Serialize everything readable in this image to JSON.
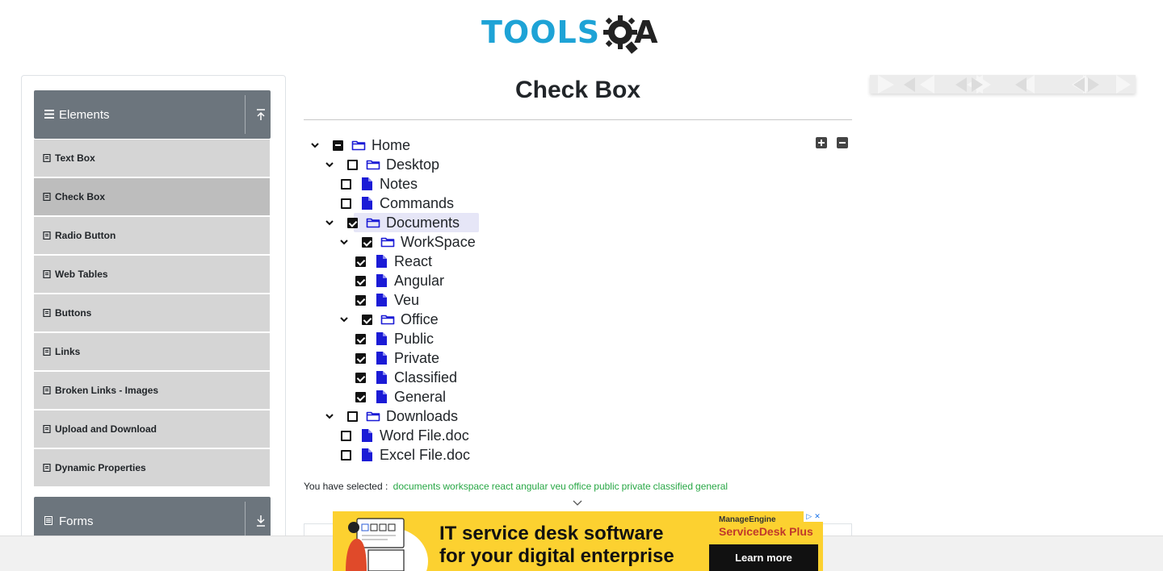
{
  "logo": {
    "text_main": "TOOLS",
    "text_q": "Q",
    "text_a": "A"
  },
  "sidebar": {
    "group_elements": {
      "label": "Elements"
    },
    "items": [
      {
        "label": "Text Box",
        "active": false
      },
      {
        "label": "Check Box",
        "active": true
      },
      {
        "label": "Radio Button",
        "active": false
      },
      {
        "label": "Web Tables",
        "active": false
      },
      {
        "label": "Buttons",
        "active": false
      },
      {
        "label": "Links",
        "active": false
      },
      {
        "label": "Broken Links - Images",
        "active": false
      },
      {
        "label": "Upload and Download",
        "active": false
      },
      {
        "label": "Dynamic Properties",
        "active": false
      }
    ],
    "group_forms": {
      "label": "Forms"
    }
  },
  "main": {
    "title": "Check Box",
    "tree": [
      {
        "label": "Home",
        "type": "folder",
        "state": "half",
        "expanded": true
      },
      {
        "label": "Desktop",
        "type": "folder",
        "state": "unchecked",
        "expanded": true
      },
      {
        "label": "Notes",
        "type": "file",
        "state": "unchecked"
      },
      {
        "label": "Commands",
        "type": "file",
        "state": "unchecked"
      },
      {
        "label": "Documents",
        "type": "folder",
        "state": "checked",
        "expanded": true,
        "highlighted": true
      },
      {
        "label": "WorkSpace",
        "type": "folder",
        "state": "checked",
        "expanded": true
      },
      {
        "label": "React",
        "type": "file",
        "state": "checked"
      },
      {
        "label": "Angular",
        "type": "file",
        "state": "checked"
      },
      {
        "label": "Veu",
        "type": "file",
        "state": "checked"
      },
      {
        "label": "Office",
        "type": "folder",
        "state": "checked",
        "expanded": true
      },
      {
        "label": "Public",
        "type": "file",
        "state": "checked"
      },
      {
        "label": "Private",
        "type": "file",
        "state": "checked"
      },
      {
        "label": "Classified",
        "type": "file",
        "state": "checked"
      },
      {
        "label": "General",
        "type": "file",
        "state": "checked"
      },
      {
        "label": "Downloads",
        "type": "folder",
        "state": "unchecked",
        "expanded": true
      },
      {
        "label": "Word File.doc",
        "type": "file",
        "state": "unchecked"
      },
      {
        "label": "Excel File.doc",
        "type": "file",
        "state": "unchecked"
      }
    ],
    "result": {
      "label": "You have selected :",
      "items": [
        "documents",
        "workspace",
        "react",
        "angular",
        "veu",
        "office",
        "public",
        "private",
        "classified",
        "general"
      ]
    }
  },
  "banner": {
    "headline_1": "IT service desk software",
    "headline_2": "for your digital enterprise",
    "brand_1": "ManageEngine",
    "brand_2": "ServiceDesk Plus",
    "cta": "Learn more"
  },
  "colors": {
    "logo_blue": "#1ea3d6",
    "sidebar_header": "#6c757d",
    "menu_item_bg": "#d5d5d5",
    "menu_item_active": "#bdbdbd",
    "folder_icon": "#1b1bd6",
    "selected_text": "#28a745",
    "banner_bg": "#fcd130"
  }
}
